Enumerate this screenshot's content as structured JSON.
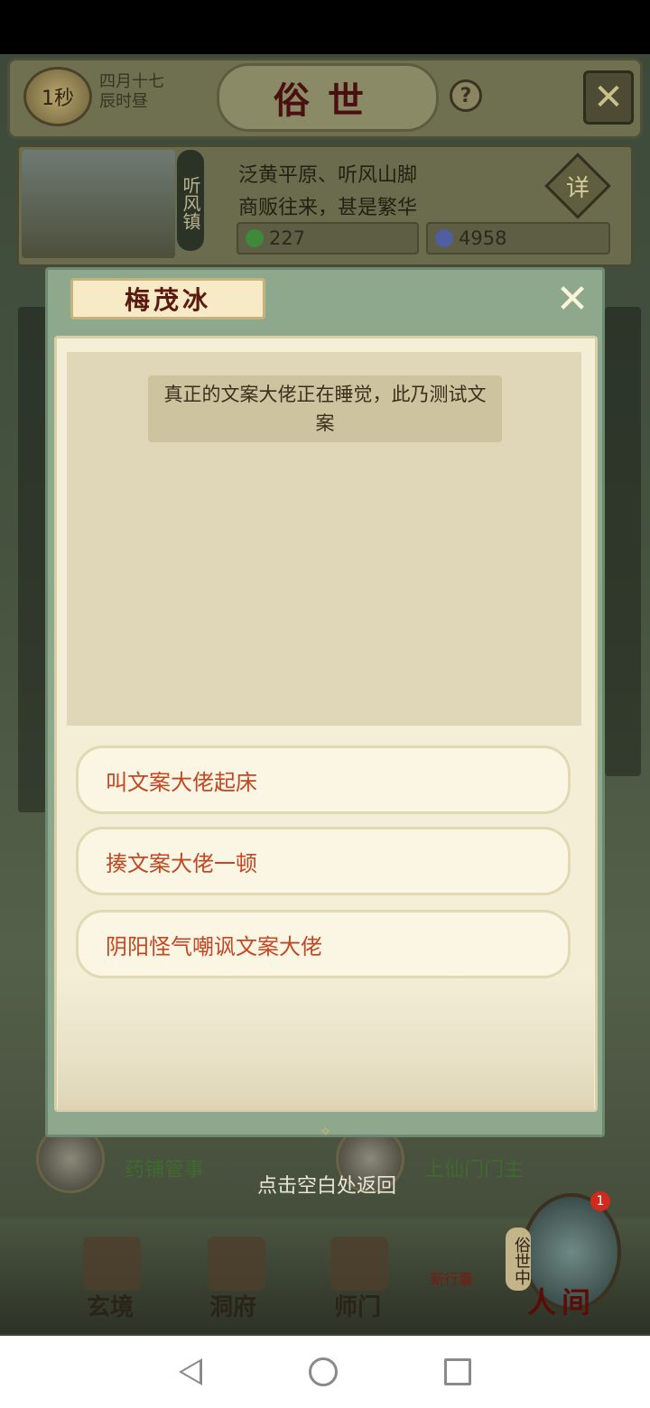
{
  "topbar": {
    "timer": "1秒",
    "date_line1": "四月十七",
    "date_line2": "辰时昼",
    "title": "俗世",
    "help_label": "?",
    "close_label": "✕"
  },
  "location": {
    "tag": "听风镇",
    "line1": "泛黄平原、听风山脚",
    "line2": "商贩往来，甚是繁华",
    "detail_label": "详",
    "resource1": "227",
    "resource2": "4958"
  },
  "dialog": {
    "name": "梅茂冰",
    "close_label": "✕",
    "message": "真正的文案大佬正在睡觉，此乃测试文案",
    "choices": [
      "叫文案大佬起床",
      "揍文案大佬一顿",
      "阴阳怪气嘲讽文案大佬"
    ]
  },
  "background_chars": [
    {
      "role": "药铺管事"
    },
    {
      "role": "上仙门门主"
    }
  ],
  "hint": "点击空白处返回",
  "bottom_nav": {
    "items": [
      "玄境",
      "洞府",
      "师门"
    ],
    "new_label": "新行囊",
    "vertical_label": "俗世中",
    "world_label": "人间",
    "badge_count": "1"
  },
  "colors": {
    "accent_text": "#c24722",
    "dialog_bg": "#f4eed7",
    "frame": "#8da88c"
  }
}
